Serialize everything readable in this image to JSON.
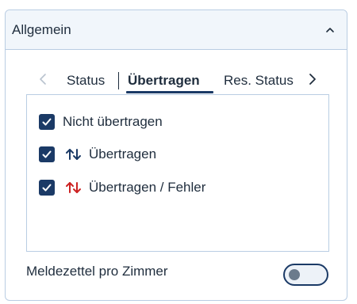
{
  "panel": {
    "title": "Allgemein",
    "collapse_icon": "chevron-up-icon"
  },
  "tabs": {
    "prev_icon": "chevron-left-icon",
    "next_icon": "chevron-right-icon",
    "items": [
      {
        "label": "Status",
        "active": false
      },
      {
        "label": "Übertragen",
        "active": true
      },
      {
        "label": "Res. Status",
        "active": false
      }
    ]
  },
  "filters": [
    {
      "label": "Nicht übertragen",
      "checked": true,
      "icon": null
    },
    {
      "label": "Übertragen",
      "checked": true,
      "icon": "transfer-arrows-icon",
      "icon_color": "#1b3a66"
    },
    {
      "label": "Übertragen / Fehler",
      "checked": true,
      "icon": "transfer-error-arrows-icon",
      "icon_color": "#cc2222"
    }
  ],
  "toggle": {
    "label": "Meldezettel pro Zimmer",
    "on": false
  },
  "colors": {
    "accent": "#1b3a66",
    "border": "#b9cde3",
    "header_bg": "#f1f6fb",
    "error": "#cc2222"
  }
}
